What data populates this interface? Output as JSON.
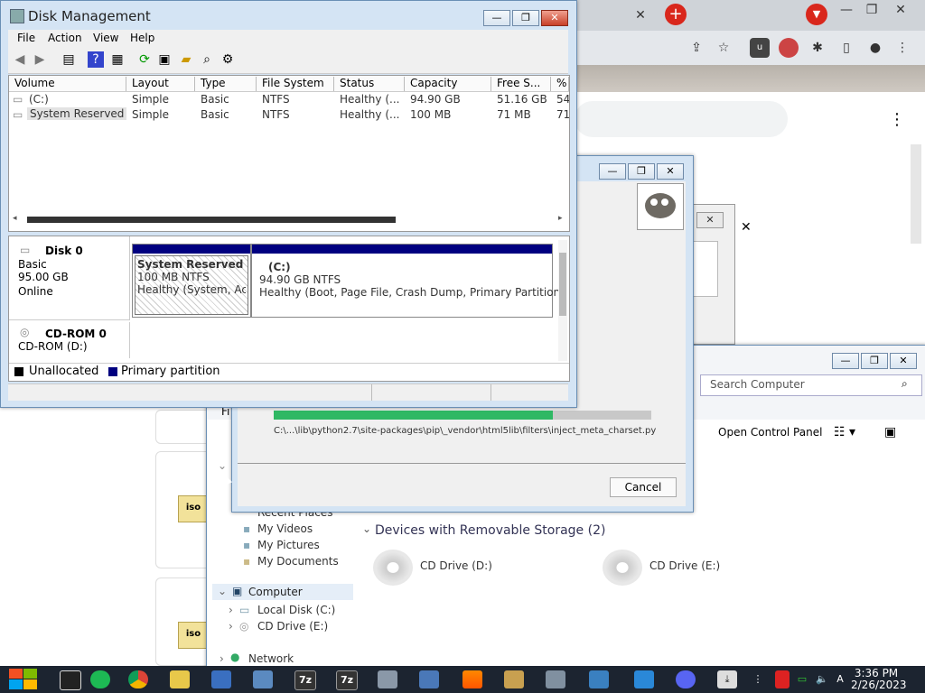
{
  "disk_management": {
    "title": "Disk Management",
    "menu": [
      "File",
      "Action",
      "View",
      "Help"
    ],
    "columns": [
      "Volume",
      "Layout",
      "Type",
      "File System",
      "Status",
      "Capacity",
      "Free S...",
      "%"
    ],
    "volumes": [
      {
        "volume": "(C:)",
        "layout": "Simple",
        "type": "Basic",
        "fs": "NTFS",
        "status": "Healthy (...",
        "capacity": "94.90 GB",
        "free": "51.16 GB",
        "pct": "54"
      },
      {
        "volume": "System Reserved",
        "layout": "Simple",
        "type": "Basic",
        "fs": "NTFS",
        "status": "Healthy (...",
        "capacity": "100 MB",
        "free": "71 MB",
        "pct": "71"
      }
    ],
    "disk0": {
      "name": "Disk 0",
      "kind": "Basic",
      "size": "95.00 GB",
      "state": "Online"
    },
    "partitions": [
      {
        "name": "System Reserved",
        "size": "100 MB NTFS",
        "status": "Healthy (System, Acti"
      },
      {
        "name": "(C:)",
        "size": "94.90 GB NTFS",
        "status": "Healthy (Boot, Page File, Crash Dump, Primary Partition)"
      }
    ],
    "cdrom0": {
      "name": "CD-ROM 0",
      "drive": "CD-ROM (D:)"
    },
    "legend": [
      {
        "label": "Unallocated",
        "color": "#000000"
      },
      {
        "label": "Primary partition",
        "color": "#000080"
      }
    ]
  },
  "gimp_dialog": {
    "path": "C:\\...\\lib\\python2.7\\site-packages\\pip\\_vendor\\html5lib\\filters\\inject_meta_charset.py",
    "progress": 0.74,
    "cancel_label": "Cancel"
  },
  "explorer": {
    "search_placeholder": "Search Computer",
    "open_control_panel": "Open Control Panel",
    "menu_fragment": "Fi",
    "nav": {
      "recent_places": "Recent Places",
      "my_videos": "My Videos",
      "my_pictures": "My Pictures",
      "my_documents": "My Documents",
      "computer": "Computer",
      "local_disk": "Local Disk (C:)",
      "cd_drive_e": "CD Drive (E:)",
      "network": "Network"
    },
    "section_title": "Devices with Removable Storage (2)",
    "devices": [
      "CD Drive (D:)",
      "CD Drive (E:)"
    ]
  },
  "chrome": {
    "tab_close": "✕",
    "new_tab": "+"
  },
  "taskbar": {
    "time": "3:36 PM",
    "date": "2/26/2023",
    "apps": [
      "7z",
      "7z"
    ]
  },
  "colors": {
    "primary_partition": "#000080",
    "progress": "#2fb864",
    "chrome_red": "#d9271c"
  }
}
